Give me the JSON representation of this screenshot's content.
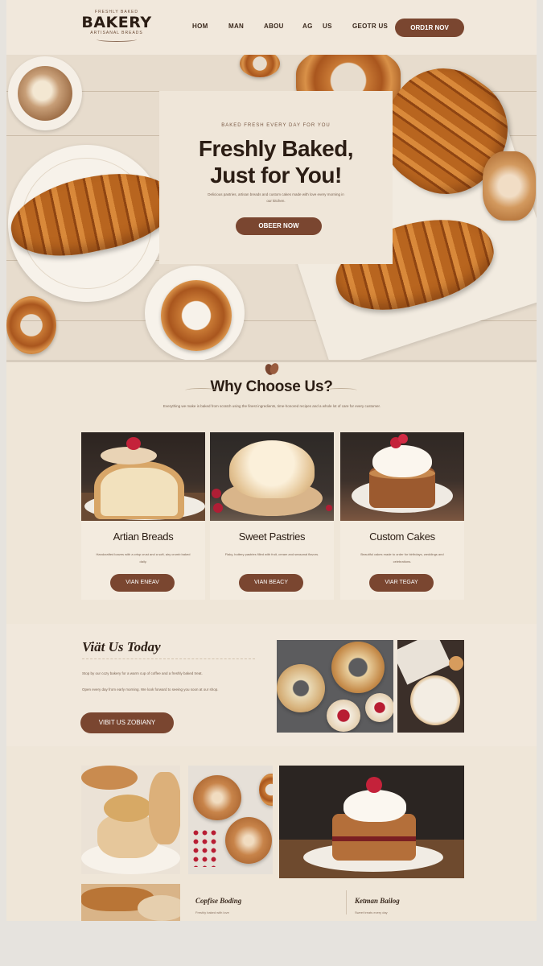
{
  "header": {
    "logo_top": "FRESHLY BAKED",
    "logo_word": "BAKERY",
    "logo_bottom": "ARTISANAL BREADS",
    "nav": [
      "HOM",
      "MAN",
      "ABOU",
      "AG",
      "US",
      "GEOTR US"
    ],
    "cta_label": "ORD1R NOV"
  },
  "hero": {
    "kicker": "BAKED FRESH EVERY DAY FOR YOU",
    "title_line1": "Freshly Baked,",
    "title_line2": "Just for You!",
    "description": "Delicious pastries, artisan breads and custom cakes made with love every morning in our kitchen.",
    "button_label": "OBEER NOW"
  },
  "why": {
    "title": "Why Choose Us?",
    "description": "Everything we make is baked from scratch using the finest ingredients, time-honored recipes and a whole lot of care for every customer."
  },
  "cards": [
    {
      "name": "Artian Breads",
      "description": "Handcrafted loaves with a crisp crust and a soft, airy crumb baked daily.",
      "button": "VIAN ENEAV"
    },
    {
      "name": "Sweet Pastries",
      "description": "Flaky, buttery pastries filled with fruit, cream and seasonal flavors.",
      "button": "VIAN BEACY"
    },
    {
      "name": "Custom Cakes",
      "description": "Beautiful cakes made to order for birthdays, weddings and celebrations.",
      "button": "VIAR TEGAY"
    }
  ],
  "visit": {
    "title": "Viät Us Today",
    "description1": "Stop by our cozy bakery for a warm cup of coffee and a freshly baked treat.",
    "description2": "Open every day from early morning. We look forward to seeing you soon at our shop.",
    "button_label": "VIBIT US ZOBIANY"
  },
  "gallery": {
    "caption1": "Copfise Boding",
    "sub1": "Freshly baked with love",
    "caption2": "Ketman Bailog",
    "sub2": "Sweet treats every day"
  },
  "colors": {
    "accent": "#7a4630",
    "background": "#efe6d8",
    "text": "#2b1d14"
  }
}
